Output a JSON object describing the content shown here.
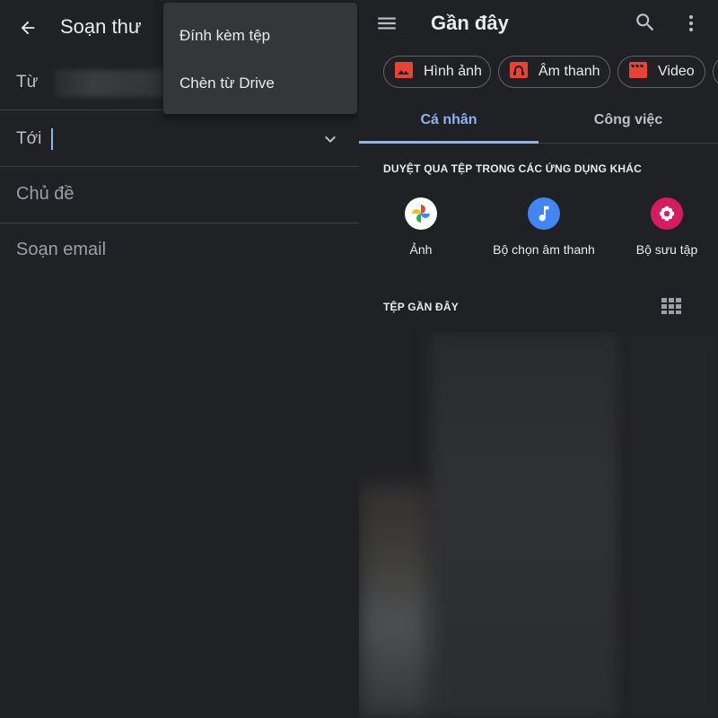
{
  "compose": {
    "title": "Soạn thư",
    "from_label": "Từ",
    "to_label": "Tới",
    "subject_placeholder": "Chủ đề",
    "body_placeholder": "Soạn email",
    "attach_menu": {
      "attach_file": "Đính kèm tệp",
      "insert_from_drive": "Chèn từ Drive"
    }
  },
  "picker": {
    "title": "Gần đây",
    "chips": [
      {
        "label": "Hình ảnh",
        "icon": "image-icon"
      },
      {
        "label": "Âm thanh",
        "icon": "audio-icon"
      },
      {
        "label": "Video",
        "icon": "video-icon"
      }
    ],
    "tabs": {
      "personal": "Cá nhân",
      "work": "Công việc"
    },
    "browse_heading": "DUYỆT QUA TỆP TRONG CÁC ỨNG DỤNG KHÁC",
    "apps": [
      {
        "label": "Ảnh",
        "icon": "google-photos-icon"
      },
      {
        "label": "Bộ chọn âm thanh",
        "icon": "music-note-icon"
      },
      {
        "label": "Bộ sưu tập",
        "icon": "gallery-flower-icon"
      }
    ],
    "recent_heading": "TỆP GẦN ĐÂY"
  },
  "colors": {
    "accent": "#8ab4f8",
    "chip_icon_red": "#ea4335",
    "audio_app_blue": "#4285f4",
    "gallery_app_pink": "#d81b60"
  }
}
